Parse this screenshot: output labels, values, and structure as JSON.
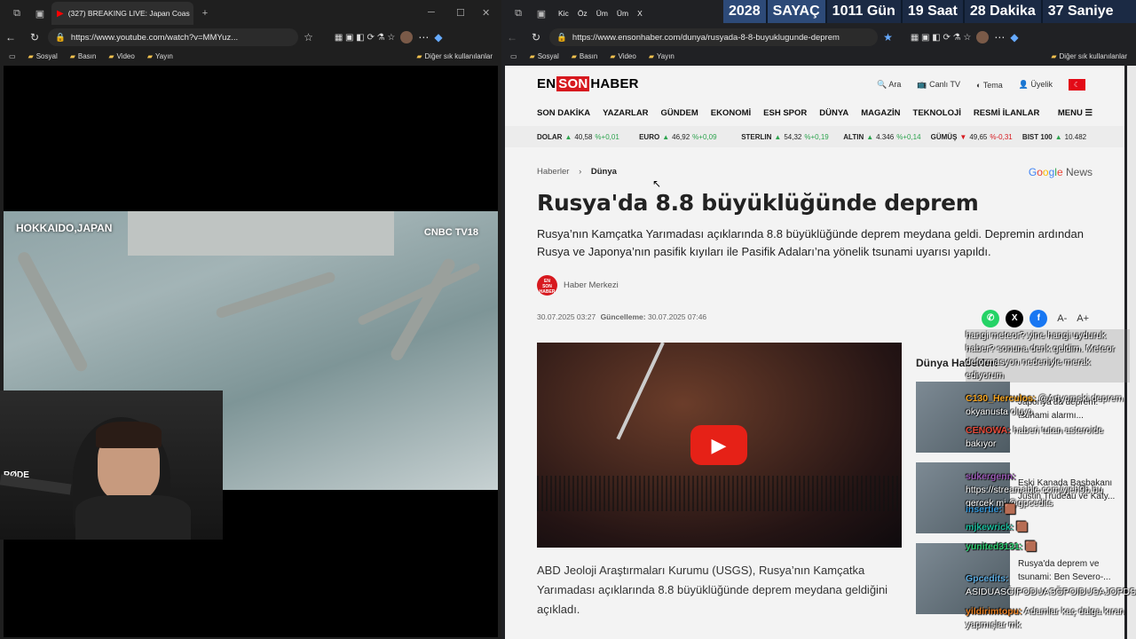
{
  "left_browser": {
    "tab_title": "(327) BREAKING LIVE: Japan Coas",
    "url": "https://www.youtube.com/watch?v=MMYuz...",
    "bookmarks": [
      "Sosyal",
      "Basın",
      "Video",
      "Yayın"
    ],
    "other_bookmarks": "Diğer sık kullanılanlar",
    "video_overlay_location": "HOKKAIDO,JAPAN",
    "video_logo": "CNBC TV18",
    "mic_label": "RØDE"
  },
  "right_browser": {
    "tabs": [
      "Kic",
      "Öz",
      "Üm",
      "Üm",
      "X"
    ],
    "url": "https://www.ensonhaber.com/dunya/rusyada-8-8-buyuklugunde-deprem",
    "bookmarks": [
      "Sosyal",
      "Basın",
      "Video",
      "Yayın"
    ],
    "other_bookmarks": "Diğer sık kullanılanlar"
  },
  "counter": {
    "year": "2028",
    "label": "SAYAÇ",
    "days": "1011 Gün",
    "hours": "19 Saat",
    "minutes": "28 Dakika",
    "seconds": "37 Saniye"
  },
  "site": {
    "logo_en": "EN",
    "logo_son": "SON",
    "logo_haber": "HABER",
    "tools": {
      "search": "Ara",
      "live_tv": "Canlı TV",
      "theme": "Tema",
      "member": "Üyelik"
    },
    "nav": [
      "SON DAKİKA",
      "YAZARLAR",
      "GÜNDEM",
      "EKONOMİ",
      "ESH SPOR",
      "DÜNYA",
      "MAGAZİN",
      "TEKNOLOJİ",
      "RESMİ İLANLAR"
    ],
    "menu": "MENU",
    "ticker": [
      {
        "name": "DOLAR",
        "value": "40,58",
        "change": "%+0,01",
        "dir": "up"
      },
      {
        "name": "EURO",
        "value": "46,92",
        "change": "%+0,09",
        "dir": "up"
      },
      {
        "name": "STERLIN",
        "value": "54,32",
        "change": "%+0,19",
        "dir": "up"
      },
      {
        "name": "ALTIN",
        "value": "4.346",
        "change": "%+0,14",
        "dir": "up"
      },
      {
        "name": "GÜMÜŞ",
        "value": "49,65",
        "change": "%-0,31",
        "dir": "down"
      },
      {
        "name": "BIST 100",
        "value": "10.482",
        "change": "",
        "dir": "up"
      }
    ]
  },
  "article": {
    "breadcrumb_root": "Haberler",
    "breadcrumb_current": "Dünya",
    "google_news": "Google News",
    "title": "Rusya'da 8.8 büyüklüğünde deprem",
    "summary": "Rusya’nın Kamçatka Yarımadası açıklarında 8.8 büyüklüğünde deprem meydana geldi. Depremin ardından Rusya ve Japonya’nın pasifik kıyıları ile Pasifik Adaları’na yönelik tsunami uyarısı yapıldı.",
    "author": "Haber Merkezi",
    "date": "30.07.2025 03:27",
    "updated_label": "Güncelleme:",
    "updated": "30.07.2025 07:46",
    "font_minus": "A-",
    "font_plus": "A+",
    "body": "ABD Jeoloji Araştırmaları Kurumu (USGS), Rusya’nın Kamçatka Yarımadası açıklarında 8.8 büyüklüğünde deprem meydana geldiğini açıkladı."
  },
  "sidebar": {
    "title": "Dünya Haberleri",
    "items": [
      {
        "text": "Japonya'da deprem: tsunami alarmı..."
      },
      {
        "text": "Eski Kanada Başbakanı Justin Trudeau ve Katy..."
      },
      {
        "text": "Rusya'da deprem ve tsunami: Ben Severo-..."
      }
    ]
  },
  "chat": [
    {
      "user": "",
      "msg": "hangi meteor? yine hangi uyduruk haber? sonuna denk geldim. Meteor deformasyon nedeniyle merak ediyorum"
    },
    {
      "user": "C130_Herculos:",
      "msg": "@Artyomski deprem okyanusta oluyo"
    },
    {
      "user": "CENOWA:",
      "msg": "haberi tutan asteroide bakıyor"
    },
    {
      "user": "sukergenn:",
      "msg": "https://streamable.com/yjeh9b bu gercek mi @gpcedits"
    },
    {
      "user": "insertie:",
      "msg": "🟫"
    },
    {
      "user": "mjkewrick:",
      "msg": "🟫"
    },
    {
      "user": "yunited3131:",
      "msg": "🟫"
    },
    {
      "user": "Gpcedits:",
      "msg": "ASIDUASĞIPODUASĞPOIDUSAJOPDSA"
    },
    {
      "user": "yildirimtopu:",
      "msg": "Adamlar kaç dalga kıran yapmışlar mk"
    }
  ]
}
